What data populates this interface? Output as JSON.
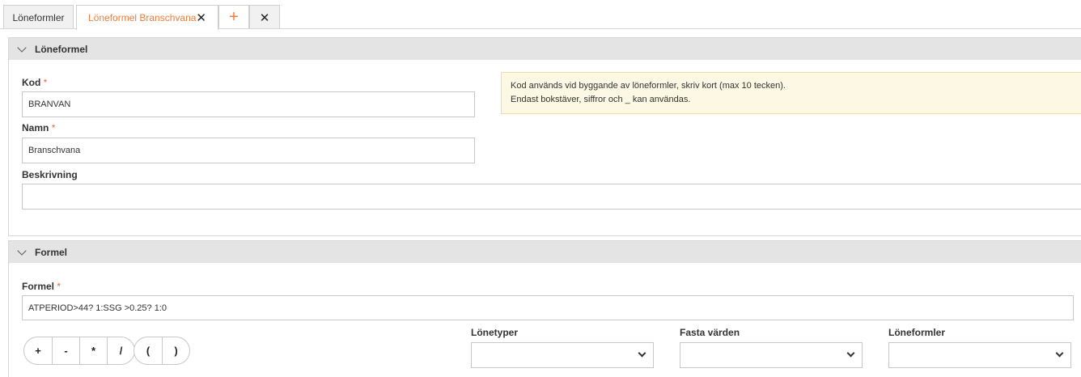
{
  "tabs": {
    "tab1_label": "Löneformler",
    "tab2_label": "Löneformel Branschvana",
    "tab2_close": "✕",
    "add_label": "+",
    "close_label": "✕"
  },
  "section1": {
    "title": "Löneformel",
    "kod_label": "Kod",
    "kod_value": "BRANVAN",
    "namn_label": "Namn",
    "namn_value": "Branschvana",
    "beskrivning_label": "Beskrivning",
    "beskrivning_value": "",
    "required_mark": "*",
    "info_line1": "Kod används vid byggande av löneformler, skriv kort (max 10 tecken).",
    "info_line2": "Endast bokstäver, siffror och _ kan användas."
  },
  "section2": {
    "title": "Formel",
    "formel_label": "Formel",
    "formel_value": "ATPERIOD>44? 1:SSG >0.25? 1:0",
    "operators": [
      "+",
      "-",
      "*",
      "/",
      "(",
      ")"
    ],
    "lonetyper_label": "Lönetyper",
    "fasta_label": "Fasta värden",
    "loneformler_label": "Löneformler"
  },
  "colors": {
    "accent": "#f07c3b",
    "required": "#e06a3a",
    "info_bg": "#fcf8e3"
  }
}
